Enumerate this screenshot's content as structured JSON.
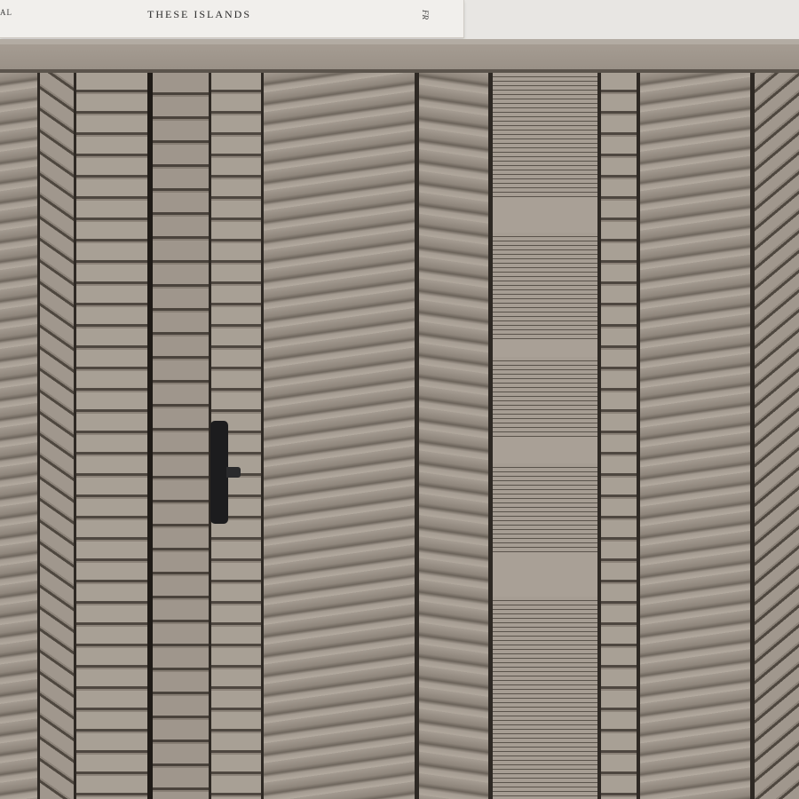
{
  "book": {
    "left_text": "AL",
    "title": "THESE ISLANDS",
    "spine_text": "FR"
  },
  "colors": {
    "wood": "#9b9288",
    "groove": "#2e2924",
    "handle": "#1c1c1e",
    "wall": "#e8e6e3"
  },
  "objects": [
    "book",
    "cabinet-top",
    "carved-door-panels",
    "door-handle"
  ]
}
